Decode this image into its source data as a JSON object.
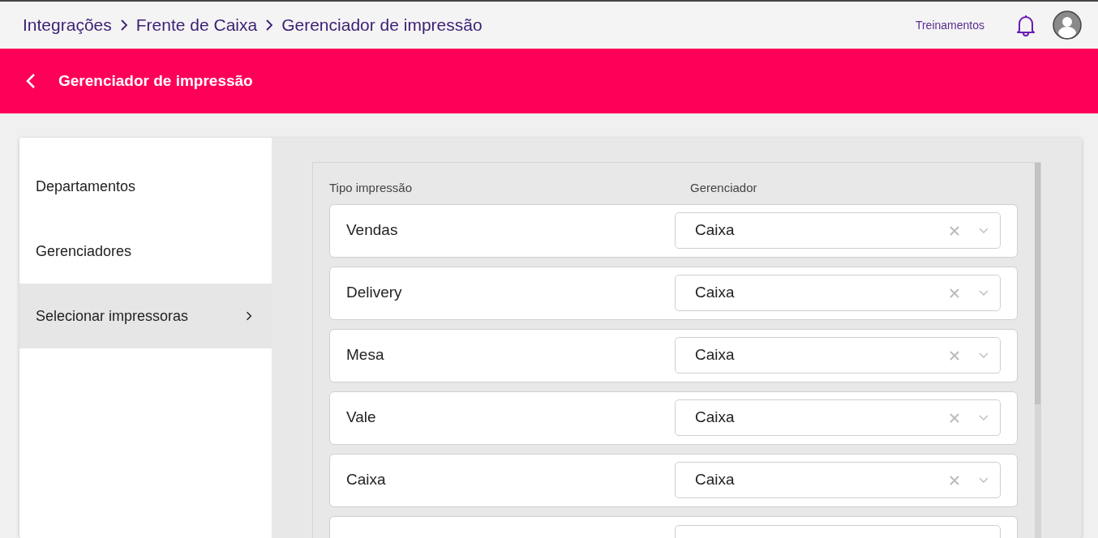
{
  "breadcrumb": [
    "Integrações",
    "Frente de Caixa",
    "Gerenciador de impressão"
  ],
  "top_links": {
    "training": "Treinamentos"
  },
  "header": {
    "title": "Gerenciador de impressão"
  },
  "sidebar": {
    "items": [
      {
        "label": "Departamentos",
        "selected": false
      },
      {
        "label": "Gerenciadores",
        "selected": false
      },
      {
        "label": "Selecionar impressoras",
        "selected": true
      }
    ]
  },
  "table": {
    "columns": [
      "Tipo impressão",
      "Gerenciador"
    ],
    "rows": [
      {
        "type": "Vendas",
        "manager": "Caixa"
      },
      {
        "type": "Delivery",
        "manager": "Caixa"
      },
      {
        "type": "Mesa",
        "manager": "Caixa"
      },
      {
        "type": "Vale",
        "manager": "Caixa"
      },
      {
        "type": "Caixa",
        "manager": "Caixa"
      }
    ]
  }
}
